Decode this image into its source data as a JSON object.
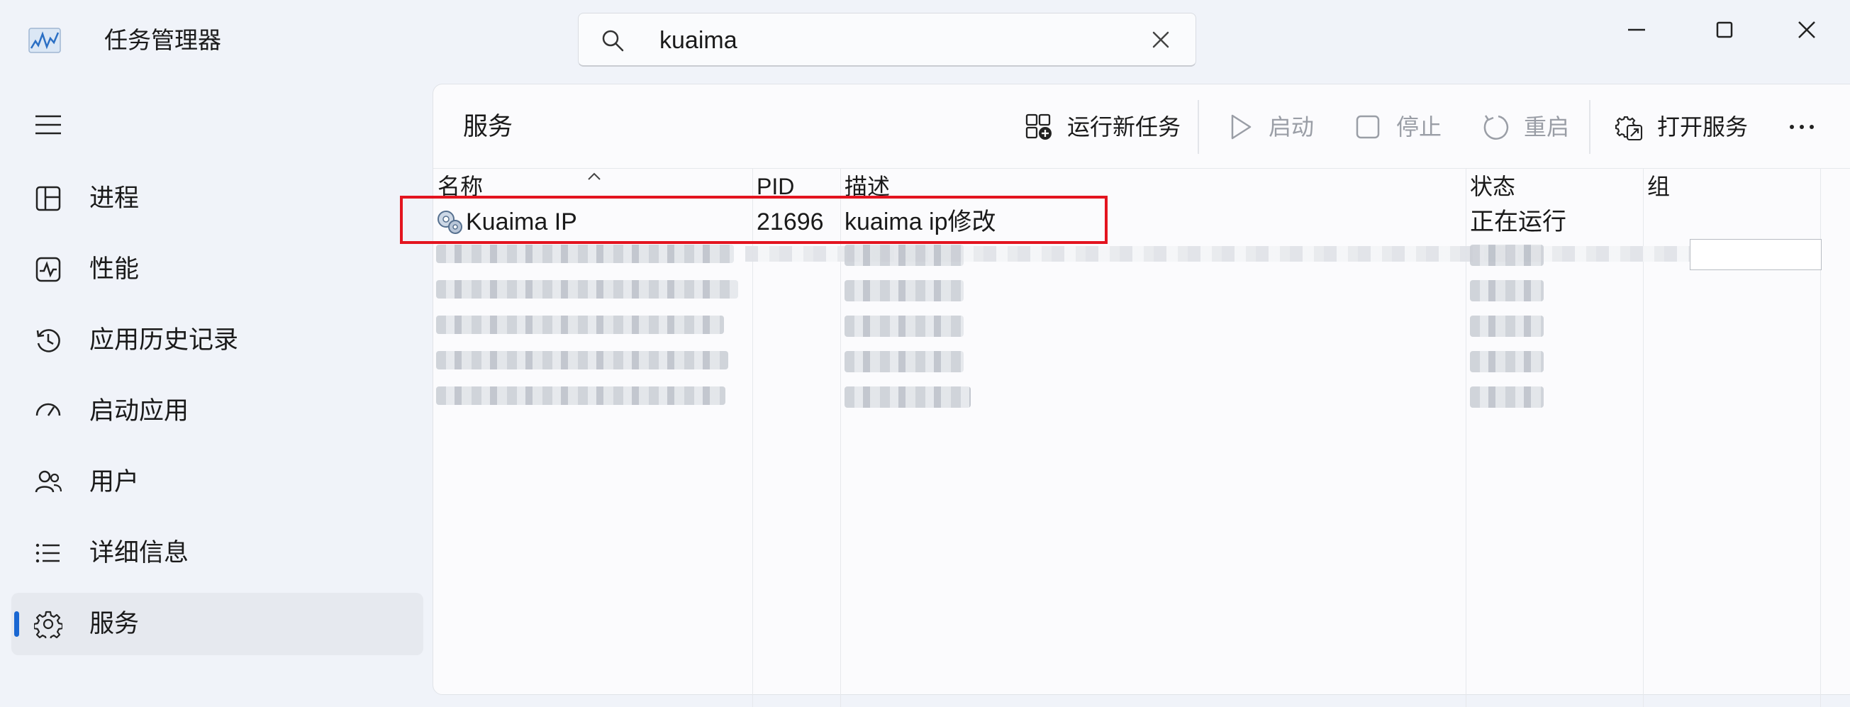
{
  "app": {
    "title": "任务管理器"
  },
  "search": {
    "value": "kuaima"
  },
  "nav": {
    "items": [
      {
        "label": "进程",
        "icon": "processes-icon"
      },
      {
        "label": "性能",
        "icon": "performance-icon"
      },
      {
        "label": "应用历史记录",
        "icon": "app-history-icon"
      },
      {
        "label": "启动应用",
        "icon": "startup-apps-icon"
      },
      {
        "label": "用户",
        "icon": "users-icon"
      },
      {
        "label": "详细信息",
        "icon": "details-icon"
      },
      {
        "label": "服务",
        "icon": "services-icon",
        "selected": true
      }
    ]
  },
  "page": {
    "title": "服务"
  },
  "toolbar": {
    "run_new_task": "运行新任务",
    "start": "启动",
    "stop": "停止",
    "restart": "重启",
    "open_services": "打开服务"
  },
  "table": {
    "columns": [
      "名称",
      "PID",
      "描述",
      "状态",
      "组"
    ],
    "rows": [
      {
        "name": "Kuaima IP",
        "pid": "21696",
        "description": "kuaima ip修改",
        "status": "正在运行",
        "group": ""
      }
    ]
  },
  "colors": {
    "accent": "#1a67d2",
    "highlight_box": "#e3141f"
  }
}
